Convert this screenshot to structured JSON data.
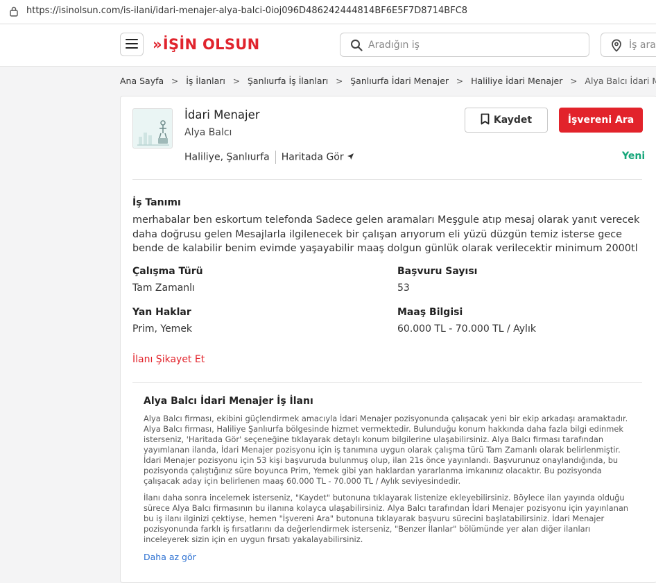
{
  "browser": {
    "url": "https://isinolsun.com/is-ilani/idari-menajer-alya-balci-0ioj096D486242444814BF6E5F7D8714BFC8"
  },
  "header": {
    "logo_arrows": "»",
    "logo_part1": "İŞİN",
    "logo_part2": "OLSUN",
    "search_placeholder": "Aradığın iş",
    "location_placeholder": "İş arac"
  },
  "breadcrumb": [
    "Ana Sayfa",
    "İş İlanları",
    "Şanlıurfa İş İlanları",
    "Şanlıurfa İdari Menajer",
    "Haliliye İdari Menajer",
    "Alya Balcı İdari Menajer"
  ],
  "breadcrumb_sep": ">",
  "job": {
    "title": "İdari Menajer",
    "company": "Alya Balcı",
    "location": "Haliliye, Şanlıurfa",
    "map_link": "Haritada Gör",
    "save_label": "Kaydet",
    "call_label": "İşvereni Ara",
    "badge": "Yeni"
  },
  "description": {
    "title": "İş Tanımı",
    "text": "merhabalar ben eskortum telefonda Sadece gelen aramaları Meşgule atıp mesaj olarak yanıt verecek daha doğrusu gelen Mesajlarla ilgilenecek bir çalışan arıyorum eli yüzü düzgün temiz isterse gece bende de kalabilir benim evimde yaşayabilir maaş dolgun günlük olarak verilecektir minimum 2000tl"
  },
  "details": {
    "work_type_label": "Çalışma Türü",
    "work_type_value": "Tam Zamanlı",
    "applications_label": "Başvuru Sayısı",
    "applications_value": "53",
    "benefits_label": "Yan Haklar",
    "benefits_value": "Prim, Yemek",
    "salary_label": "Maaş Bilgisi",
    "salary_value": "60.000 TL - 70.000 TL / Aylık"
  },
  "report_label": "İlanı Şikayet Et",
  "seo": {
    "title": "Alya Balcı İdari Menajer İş İlanı",
    "paragraph1": "Alya Balcı firması, ekibini güçlendirmek amacıyla İdari Menajer pozisyonunda çalışacak yeni bir ekip arkadaşı aramaktadır. Alya Balcı firması, Haliliye Şanlıurfa bölgesinde hizmet vermektedir. Bulunduğu konum hakkında daha fazla bilgi edinmek isterseniz, 'Haritada Gör' seçeneğine tıklayarak detaylı konum bilgilerine ulaşabilirsiniz. Alya Balcı firması tarafından yayımlanan ilanda, İdari Menajer pozisyonu için iş tanımına uygun olarak çalışma türü Tam Zamanlı olarak belirlenmiştir. İdari Menajer pozisyonu için 53 kişi başvuruda bulunmuş olup, ilan 21s önce yayınlandı. Başvurunuz onaylandığında, bu pozisyonda çalıştığınız süre boyunca Prim, Yemek gibi yan haklardan yararlanma imkanınız olacaktır. Bu pozisyonda çalışacak aday için belirlenen maaş 60.000 TL - 70.000 TL / Aylık seviyesindedir.",
    "paragraph2": "İlanı daha sonra incelemek isterseniz, \"Kaydet\" butonuna tıklayarak listenize ekleyebilirsiniz. Böylece ilan yayında olduğu sürece Alya Balcı firmasının bu ilanına kolayca ulaşabilirsiniz. Alya Balcı tarafından İdari Menajer pozisyonu için yayınlanan bu iş ilanı ilginizi çektiyse, hemen \"İşvereni Ara\" butonuna tıklayarak başvuru sürecini başlatabilirsiniz. İdari Menajer pozisyonunda farklı iş fırsatlarını da değerlendirmek isterseniz, \"Benzer İlanlar\" bölümünde yer alan diğer ilanları inceleyerek sizin için en uygun fırsatı yakalayabilirsiniz.",
    "toggle_label": "Daha az gör"
  },
  "icons": {
    "lock": "lock-icon",
    "menu": "hamburger-menu-icon",
    "search": "search-icon",
    "location": "location-pin-icon",
    "bookmark": "bookmark-icon",
    "map_arrow": "navigation-arrow-icon"
  },
  "colors": {
    "brand_red": "#e2232b",
    "new_badge_green": "#16a67a",
    "link_blue": "#2a6fd1"
  }
}
